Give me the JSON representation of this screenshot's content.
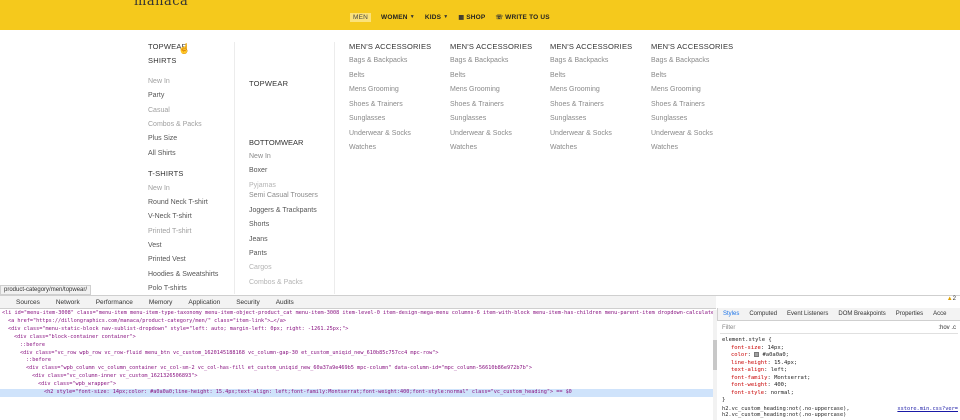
{
  "brand": {
    "logo": "manaca"
  },
  "nav": {
    "items": [
      {
        "label": "MEN",
        "active": true
      },
      {
        "label": "WOMEN",
        "caret": true
      },
      {
        "label": "KIDS",
        "caret": true
      },
      {
        "label": "SHOP",
        "icon": "store-icon"
      },
      {
        "label": "WRITE TO US",
        "icon": "phone-icon"
      }
    ]
  },
  "mega": {
    "col_a": {
      "topwear": "TOPWEAR",
      "shirts": "SHIRTS",
      "shirts_items": [
        "New In",
        "Party",
        "Casual",
        "Combos & Packs",
        "Plus Size",
        "All Shirts"
      ],
      "tshirts": "T-SHIRTS",
      "tshirts_items": [
        "New In",
        "Round Neck T-shirt",
        "V-Neck T-shirt",
        "Printed T-shirt",
        "Vest",
        "Printed Vest",
        "Hoodies & Sweatshirts",
        "Polo T-shirts"
      ]
    },
    "col_b": {
      "topwear": "TOPWEAR",
      "bottomwear": "BOTTOMWEAR",
      "items": [
        "New In",
        "Boxer",
        "Pyjamas",
        "Semi Casual Trousers",
        "Joggers & Trackpants",
        "Shorts",
        "Jeans",
        "Pants",
        "Cargos",
        "Combos & Packs"
      ]
    },
    "accessories": {
      "heading": "MEN'S ACCESSORIES",
      "items": [
        "Bags & Backpacks",
        "Belts",
        "Mens Grooming",
        "Shoes & Trainers",
        "Sunglasses",
        "Underwear & Socks",
        "Watches"
      ]
    }
  },
  "status_url": "product-category/men/topwear/",
  "devtools": {
    "tabs": [
      "Sources",
      "Network",
      "Performance",
      "Memory",
      "Application",
      "Security",
      "Audits"
    ],
    "code_lines": [
      "<li id=\"menu-item-3008\" class=\"menu-item menu-item-type-taxonomy menu-item-object-product_cat menu-item-3008 item-level-0 item-design-mega-menu columns-6 item-with-block menu-item-has-children menu-parent-item dropdown-calculated\">",
      "<a href=\"https://dillongraphics.com/manaca/product-category/men/\" class=\"item-link\">…</a>",
      "<div class=\"menu-static-block nav-sublist-dropdown\" style=\"left: auto; margin-left: 0px; right: -1261.25px;\">",
      "<div class=\"block-container container\">",
      "::before",
      "<div class=\"vc_row wpb_row vc_row-fluid menu_btn vc_custom_1620145188168 vc_column-gap-30 et_custom_uniqid_new_610b85c757cc4 mpc-row\">",
      "::before",
      "<div class=\"wpb_column vc_column_container vc_col-sm-2 vc_col-has-fill et_custom_uniqid_new_60a37a9e469b5 mpc-column\" data-column-id=\"mpc_column-56610b86e972b7b\">",
      "<div class=\"vc_column-inner vc_custom_1621326506893\">",
      "<div class=\"wpb_wrapper\">",
      "<h2 style=\"font-size: 14px;color: #a0a0a0;line-height: 15.4px;text-align: left;font-family:Montserrat;font-weight:400;font-style:normal\" class=\"vc_custom_heading\"> == $0"
    ],
    "style_tabs": [
      "Styles",
      "Computed",
      "Event Listeners",
      "DOM Breakpoints",
      "Properties",
      "Acce"
    ],
    "warning_count": "2",
    "filter_placeholder": "Filter",
    "filter_right": ":hov .c",
    "element_style": {
      "selector": "element.style {",
      "props": [
        [
          "font-size",
          "14px;"
        ],
        [
          "color",
          "#a0a0a0;"
        ],
        [
          "line-height",
          "15.4px;"
        ],
        [
          "text-align",
          "left;"
        ],
        [
          "font-family",
          "Montserrat;"
        ],
        [
          "font-weight",
          "400;"
        ],
        [
          "font-style",
          "normal;"
        ]
      ],
      "close": "}"
    },
    "rule_foot": "h2.vc_custom_heading:not(.no-uppercase),",
    "rule_foot2": "h2.vc_custom_heading:not(.no-uppercase)",
    "rule_source": "xstore.min.css?ver="
  }
}
